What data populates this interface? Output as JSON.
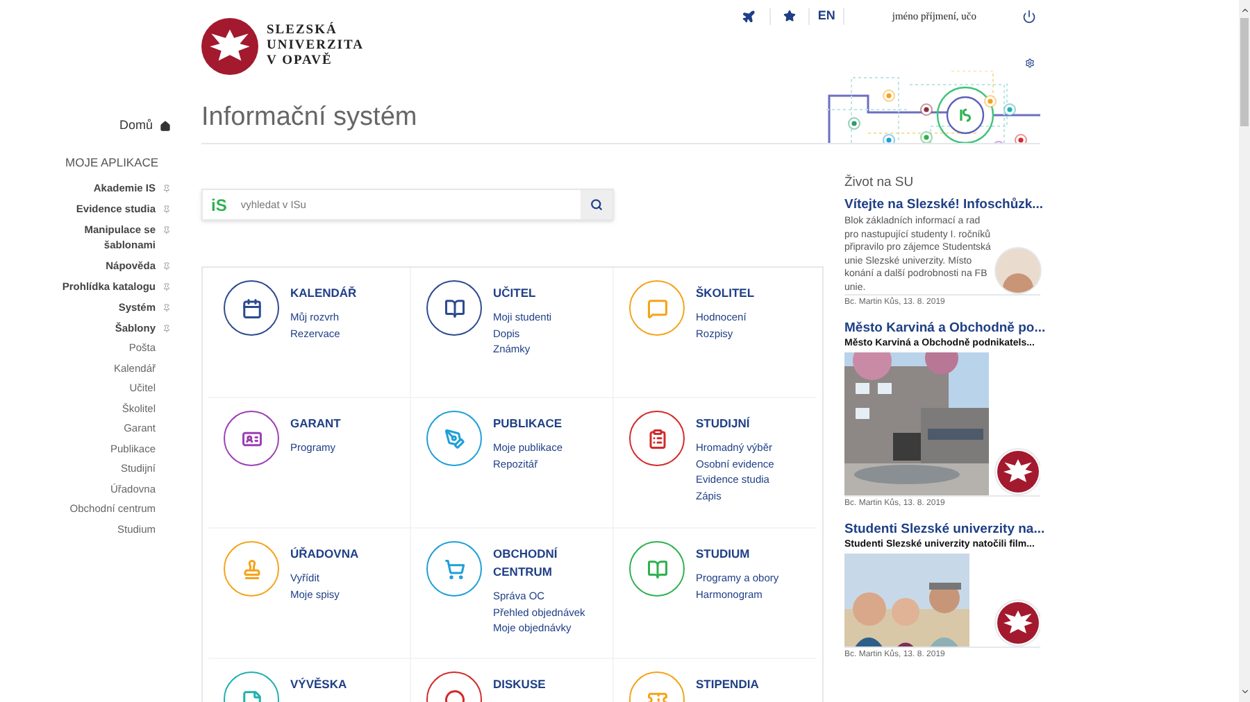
{
  "logo": {
    "lines": [
      "SLEZSKÁ",
      "UNIVERZITA",
      "V OPAVĚ"
    ]
  },
  "top_bar": {
    "language": "EN",
    "user": "jméno příjmení, učo"
  },
  "sidebar": {
    "home": "Domů",
    "section": "MOJE APLIKACE",
    "items": [
      {
        "label": "Akademie IS",
        "kind": "pinned"
      },
      {
        "label": "Evidence studia",
        "kind": "pinned"
      },
      {
        "label": "Manipulace se šablonami",
        "kind": "pinned"
      },
      {
        "label": "Nápověda",
        "kind": "pinned"
      },
      {
        "label": "Prohlídka katalogu",
        "kind": "pinned"
      },
      {
        "label": "Systém",
        "kind": "pinned"
      },
      {
        "label": "Šablony",
        "kind": "pinned"
      },
      {
        "label": "Pošta",
        "kind": "link"
      },
      {
        "label": "Kalendář",
        "kind": "link"
      },
      {
        "label": "Učitel",
        "kind": "link"
      },
      {
        "label": "Školitel",
        "kind": "link"
      },
      {
        "label": "Garant",
        "kind": "link"
      },
      {
        "label": "Publikace",
        "kind": "link"
      },
      {
        "label": "Studijní",
        "kind": "link"
      },
      {
        "label": "Úřadovna",
        "kind": "link"
      },
      {
        "label": "Obchodní centrum",
        "kind": "link"
      },
      {
        "label": "Studium",
        "kind": "link"
      }
    ]
  },
  "page_title": "Informační systém",
  "search": {
    "logo": "iS",
    "placeholder": "vyhledat v ISu"
  },
  "tiles": [
    {
      "title": "KALENDÁŘ",
      "color": "#2c4a8f",
      "links": [
        "Můj rozvrh",
        "Rezervace"
      ]
    },
    {
      "title": "UČITEL",
      "color": "#2c4a8f",
      "links": [
        "Moji studenti",
        "Dopis",
        "Známky"
      ]
    },
    {
      "title": "ŠKOLITEL",
      "color": "#f5a31a",
      "links": [
        "Hodnocení",
        "Rozpisy"
      ]
    },
    {
      "title": "GARANT",
      "color": "#9c3fb5",
      "links": [
        "Programy"
      ]
    },
    {
      "title": "PUBLIKACE",
      "color": "#1e9fd8",
      "links": [
        "Moje publikace",
        "Repozitář"
      ]
    },
    {
      "title": "STUDIJNÍ",
      "color": "#d42a2a",
      "links": [
        "Hromadný výběr",
        "Osobní evidence",
        "Evidence studia",
        "Zápis"
      ]
    },
    {
      "title": "ÚŘADOVNA",
      "color": "#f5a31a",
      "links": [
        "Vyřídit",
        "Moje spisy"
      ]
    },
    {
      "title": "OBCHODNÍ CENTRUM",
      "color": "#1e9fd8",
      "links": [
        "Správa OC",
        "Přehled objednávek",
        "Moje objednávky"
      ]
    },
    {
      "title": "STUDIUM",
      "color": "#2fb14f",
      "links": [
        "Programy a obory",
        "Harmonogram"
      ]
    },
    {
      "title": "VÝVĚSKA",
      "color": "#1fb0b0"
    },
    {
      "title": "DISKUSE",
      "color": "#d42a2a"
    },
    {
      "title": "STIPENDIA",
      "color": "#f5a31a"
    }
  ],
  "news": {
    "heading": "Život na SU",
    "items": [
      {
        "kind": "text",
        "title": "Vítejte na Slezské! Infoschůzk...",
        "text": "Blok základních informací a rad pro nastupující studenty I. ročníků připravilo pro zájemce Studentská unie Slezské univerzity. Místo konání a další podrobnosti na FB unie.",
        "byline": "Bc. Martin Kůs, 13. 8. 2019"
      },
      {
        "title": "Město Karviná a Obchodně po...",
        "text": "Město Karviná a Obchodně podnikatels...",
        "byline": "Bc. Martin Kůs, 13. 8. 2019"
      },
      {
        "title": "Studenti Slezské univerzity na...",
        "text": "Studenti Slezské univerzity natočili film...",
        "byline": "Bc. Martin Kůs, 13. 8. 2019"
      }
    ]
  }
}
